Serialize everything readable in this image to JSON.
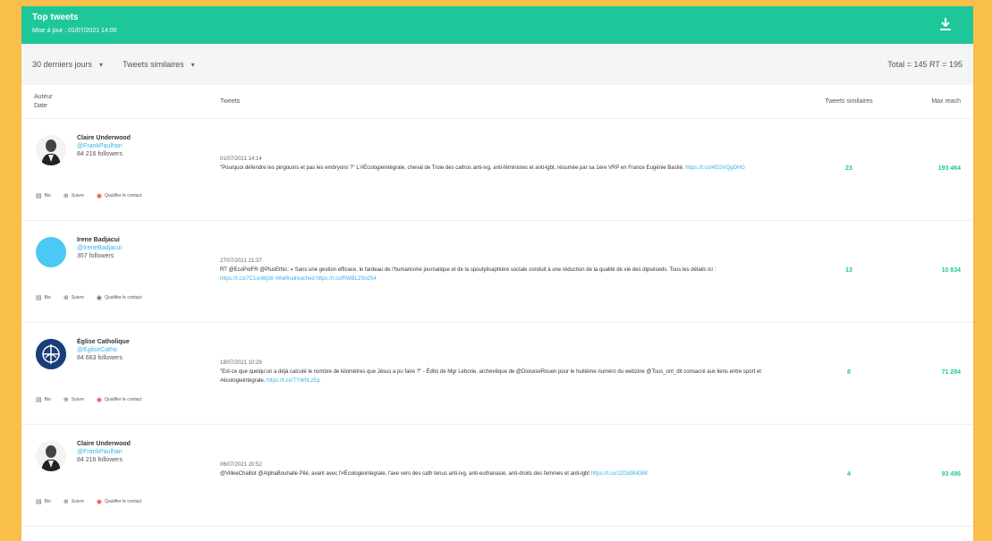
{
  "header": {
    "title": "Top tweets",
    "subtitle": "Mise à jour : 01/07/2021 14:00"
  },
  "filters": {
    "period": "30 derniers jours",
    "type": "Tweets similaires",
    "totals": "Total = 145  RT = 195"
  },
  "columns": {
    "auteur_line1": "Auteur",
    "auteur_line2": "Date",
    "tweets": "Tweets",
    "similaires": "Tweets similaires",
    "reach": "Max reach"
  },
  "actions": {
    "bio": "Bio",
    "suivre": "Suivre",
    "qualifier": "Qualifier le contact"
  },
  "rows": [
    {
      "author": "Claire Underwood",
      "handle": "@FrankPaulhan",
      "followers": "84 216 followers",
      "avatar": "person-avatar",
      "date": "01/07/2021 14:14",
      "text": "\"Pourquoi défendre les pingouins et pas les embryons ?\" L'#Écologieintégrale, cheval de Troie des cathos anti-ivg, anti-féministes et anti-lgbt, résumée par sa 1ère VRP en France Eugénie Bastié.",
      "link": "https://t.co/4EGVQgDHG",
      "similaires": "23",
      "reach": "193 464"
    },
    {
      "author": "Irene Badjacui",
      "handle": "@IreneBadjacui",
      "followers": "357 followers",
      "avatar": "blank-avatar",
      "date": "27/07/2021 21:37",
      "text": "RT @EcoPolFR @PlusEthic: « Sans une gestion efficace, le fardeau de l'humanisme journalique et de la spoutylisaphière sociale conduit à une réduction de la qualité de vie des dipséseds. Tous les détails ici : ",
      "link": "https://t.co/7C1sn6Ij38 #thefinalreached https://t.co/RWBL2Sn254",
      "similaires": "13",
      "reach": "10 834"
    },
    {
      "author": "Église Catholique",
      "handle": "@EgliseCatho",
      "followers": "84 663 followers",
      "avatar": "church-logo",
      "date": "18/07/2021 10:29",
      "text": "\"Est-ce que quelqu'un a déjà calculé le nombre de kilomètres que Jésus a pu faire ?\" - Édito de Mgr Leborie, archevêque de @DioceseRouen pour le huitième numéro du webzine @Tous_ont_dit consacré aux liens entre sport et #écologieintégrale.",
      "link": "https://t.co/TYWhLzEp",
      "similaires": "8",
      "reach": "71 284"
    },
    {
      "author": "Claire Underwood",
      "handle": "@FrankPaulhan",
      "followers": "84 216 followers",
      "avatar": "person-avatar",
      "date": "06/07/2021 20:52",
      "text": "@VilleeChaillot @AlphaBouhalle Pilé, avant avec l'#Écologieintégrale, l'axe vers des cath tenus anti-ivg, anti-euthanasie, anti-droits des femmes et anti-lgbt ",
      "link": "https://t.co/2ZDd9MD8K",
      "similaires": "4",
      "reach": "93 496"
    }
  ]
}
